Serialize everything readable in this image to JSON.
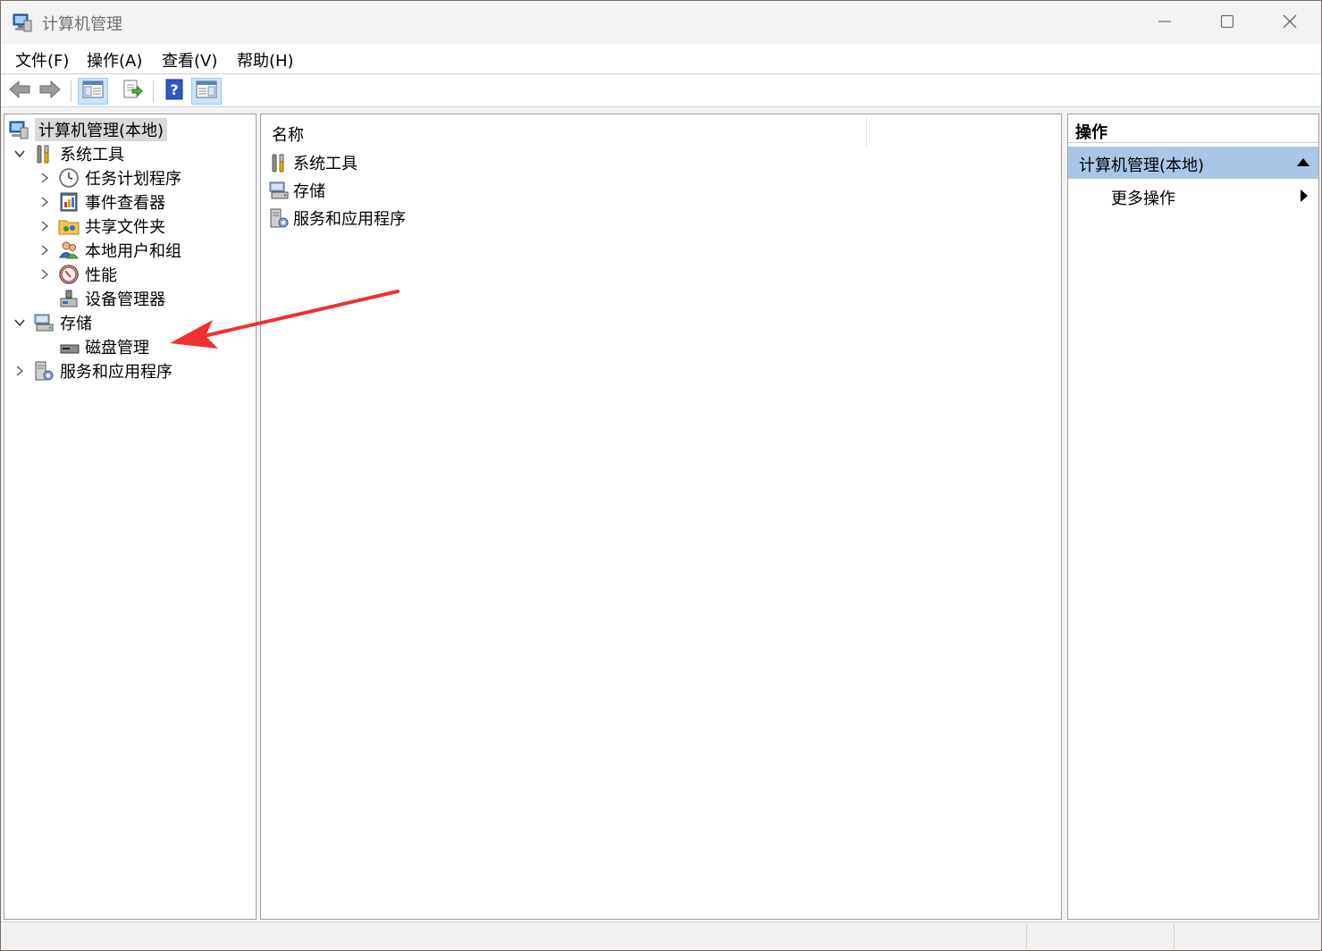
{
  "window": {
    "title": "计算机管理"
  },
  "menu": {
    "file": "文件(F)",
    "action": "操作(A)",
    "view": "查看(V)",
    "help": "帮助(H)"
  },
  "toolbar": {
    "buttons": [
      "back-icon",
      "forward-icon",
      "show-hide-tree-icon",
      "export-list-icon",
      "help-icon",
      "show-hide-action-pane-icon"
    ]
  },
  "tree": {
    "root": "计算机管理(本地)",
    "system_tools": "系统工具",
    "task_scheduler": "任务计划程序",
    "event_viewer": "事件查看器",
    "shared_folders": "共享文件夹",
    "local_users_groups": "本地用户和组",
    "performance": "性能",
    "device_manager": "设备管理器",
    "storage": "存储",
    "disk_management": "磁盘管理",
    "services_apps": "服务和应用程序"
  },
  "list": {
    "column_name": "名称",
    "items": [
      "系统工具",
      "存储",
      "服务和应用程序"
    ]
  },
  "actions": {
    "title": "操作",
    "section": "计算机管理(本地)",
    "more": "更多操作"
  },
  "colors": {
    "section_header": "#a9c6e6",
    "annotation_arrow": "#f03030",
    "toolbar_pressed": "#cce4f7"
  }
}
